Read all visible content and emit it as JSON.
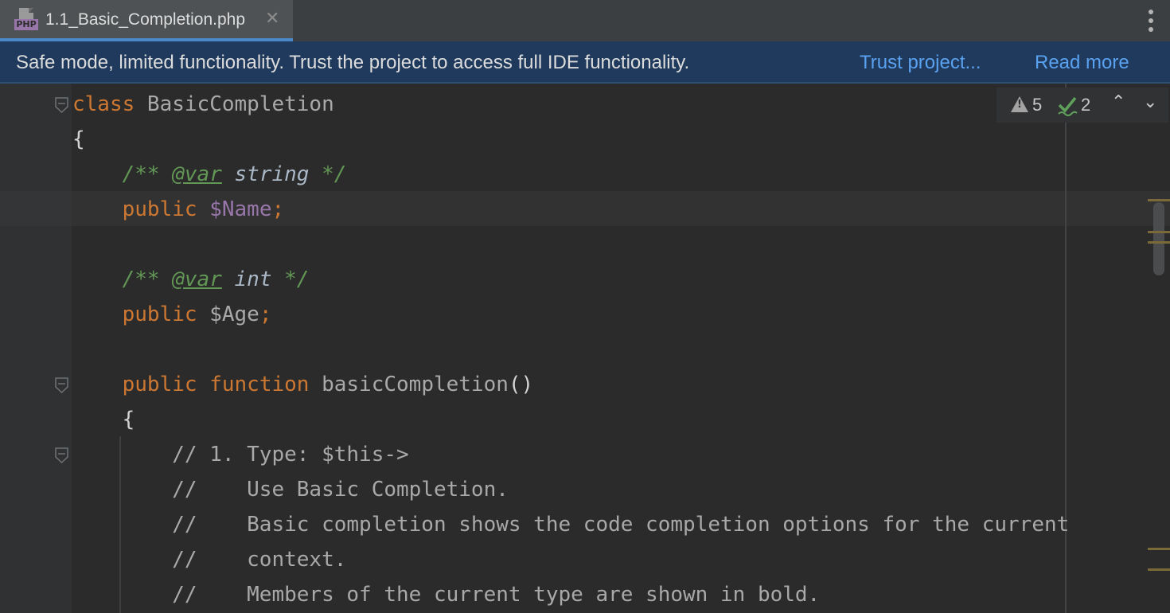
{
  "tab": {
    "icon_label": "PHP",
    "title": "1.1_Basic_Completion.php",
    "close_glyph": "✕",
    "more_icon": "more-vertical-icon"
  },
  "banner": {
    "message": "Safe mode, limited functionality. Trust the project to access full IDE functionality.",
    "trust_link": "Trust project...",
    "read_more_link": "Read more"
  },
  "inspections": {
    "warnings_count": "5",
    "weak_warnings_count": "2",
    "prev_glyph": "⌃",
    "next_glyph": "⌄"
  },
  "code": {
    "lines": [
      [
        {
          "t": "class ",
          "c": "kw"
        },
        {
          "t": "BasicCompletion",
          "c": "cls"
        }
      ],
      [
        {
          "t": "{",
          "c": "brace"
        }
      ],
      [
        {
          "t": "    "
        },
        {
          "t": "/** ",
          "c": "doc"
        },
        {
          "t": "@var",
          "c": "doc-tag"
        },
        {
          "t": " string",
          "c": "doc-type"
        },
        {
          "t": " */",
          "c": "doc"
        }
      ],
      [
        {
          "t": "    "
        },
        {
          "t": "public ",
          "c": "kw"
        },
        {
          "t": "$Name",
          "c": "var"
        },
        {
          "t": ";",
          "c": "punct"
        }
      ],
      [
        {
          "t": ""
        }
      ],
      [
        {
          "t": "    "
        },
        {
          "t": "/** ",
          "c": "doc"
        },
        {
          "t": "@var",
          "c": "doc-tag"
        },
        {
          "t": " int",
          "c": "doc-type"
        },
        {
          "t": " */",
          "c": "doc"
        }
      ],
      [
        {
          "t": "    "
        },
        {
          "t": "public ",
          "c": "kw"
        },
        {
          "t": "$Age",
          "c": "var-dim"
        },
        {
          "t": ";",
          "c": "punct"
        }
      ],
      [
        {
          "t": ""
        }
      ],
      [
        {
          "t": "    "
        },
        {
          "t": "public ",
          "c": "kw"
        },
        {
          "t": "function ",
          "c": "kw"
        },
        {
          "t": "basicCompletion",
          "c": "fn"
        },
        {
          "t": "()",
          "c": "brace"
        }
      ],
      [
        {
          "t": "    "
        },
        {
          "t": "{",
          "c": "brace"
        }
      ],
      [
        {
          "t": "        "
        },
        {
          "t": "// 1. Type: $this->",
          "c": "cmt"
        }
      ],
      [
        {
          "t": "        "
        },
        {
          "t": "//    Use Basic Completion.",
          "c": "cmt"
        }
      ],
      [
        {
          "t": "        "
        },
        {
          "t": "//    Basic completion shows the code completion options for the current",
          "c": "cmt"
        }
      ],
      [
        {
          "t": "        "
        },
        {
          "t": "//    context.",
          "c": "cmt"
        }
      ],
      [
        {
          "t": "        "
        },
        {
          "t": "//    Members of the current type are shown in bold.",
          "c": "cmt"
        }
      ]
    ]
  },
  "colors": {
    "keyword": "#cc7832",
    "variable": "#9876aa",
    "doc_comment": "#629755",
    "link": "#5aa2f0",
    "banner_bg": "#1f3a5c"
  }
}
